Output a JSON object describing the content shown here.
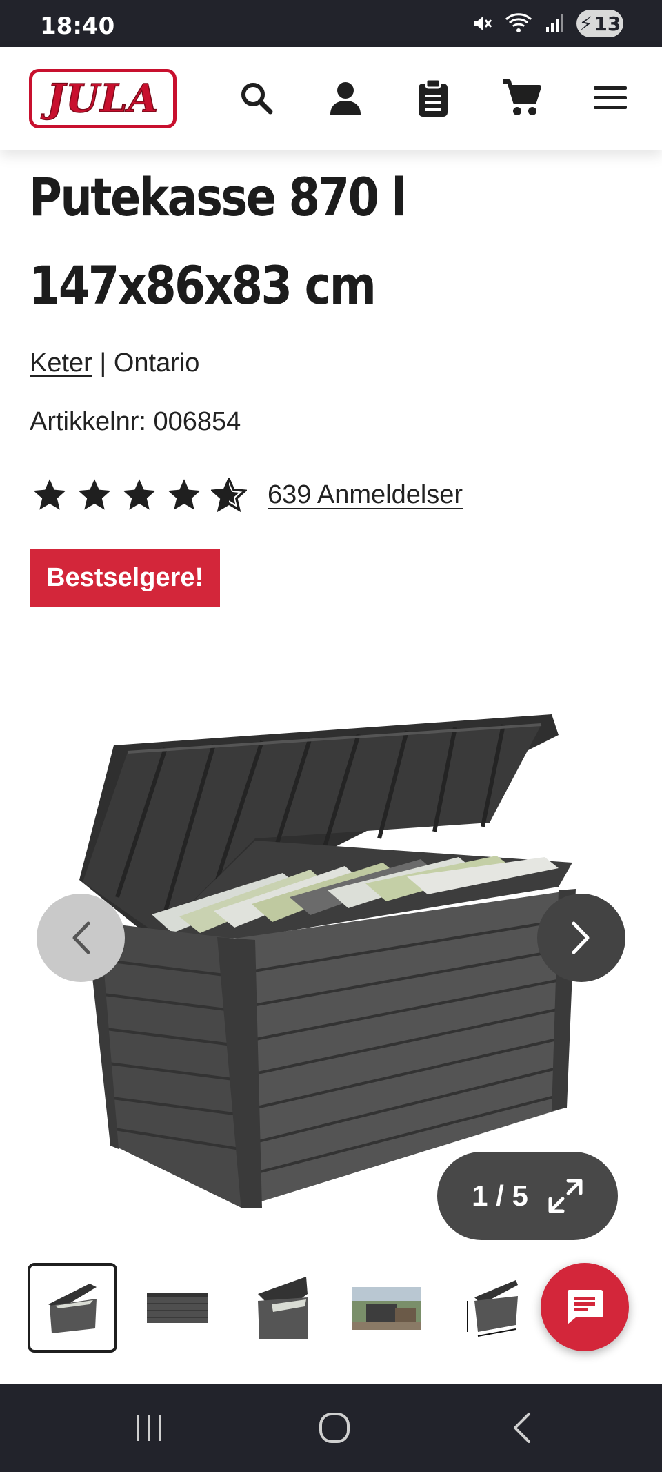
{
  "status_bar": {
    "time": "18:40",
    "battery": "13"
  },
  "header": {
    "logo_text": "JULA"
  },
  "product": {
    "title_line1": "Putekasse 870 l",
    "title_line2": "147x86x83 cm",
    "brand": "Keter",
    "separator": "|",
    "series": "Ontario",
    "article_number": "Artikkelnr: 006854",
    "rating": 4.5,
    "reviews_link": "639 Anmeldelser",
    "badge": "Bestselgere!"
  },
  "gallery": {
    "counter": "1 / 5",
    "thumbnail_count": 5
  },
  "colors": {
    "brand_red": "#d3263a",
    "dark": "#22232b"
  },
  "icons": [
    "search-icon",
    "account-icon",
    "shopping-list-icon",
    "cart-icon",
    "menu-icon",
    "chevron-left-icon",
    "chevron-right-icon",
    "expand-icon",
    "chat-icon"
  ]
}
